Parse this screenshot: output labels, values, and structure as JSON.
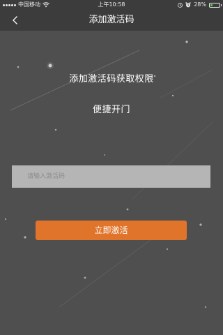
{
  "status_bar": {
    "carrier": "中国移动",
    "time": "上午10:58",
    "battery_percent": "28%",
    "battery_level": 0.28
  },
  "nav": {
    "back_icon": "chevron-left-icon",
    "title": "添加激活码"
  },
  "content": {
    "headline": "添加激活码获取权限",
    "subline": "便捷开门",
    "input_placeholder": "请输入激活码",
    "input_value": "",
    "button_label": "立即激活"
  },
  "colors": {
    "background": "#4f4f4f",
    "header": "#3c3c3c",
    "input_bg": "#b5b5b5",
    "accent": "#e0742a"
  }
}
